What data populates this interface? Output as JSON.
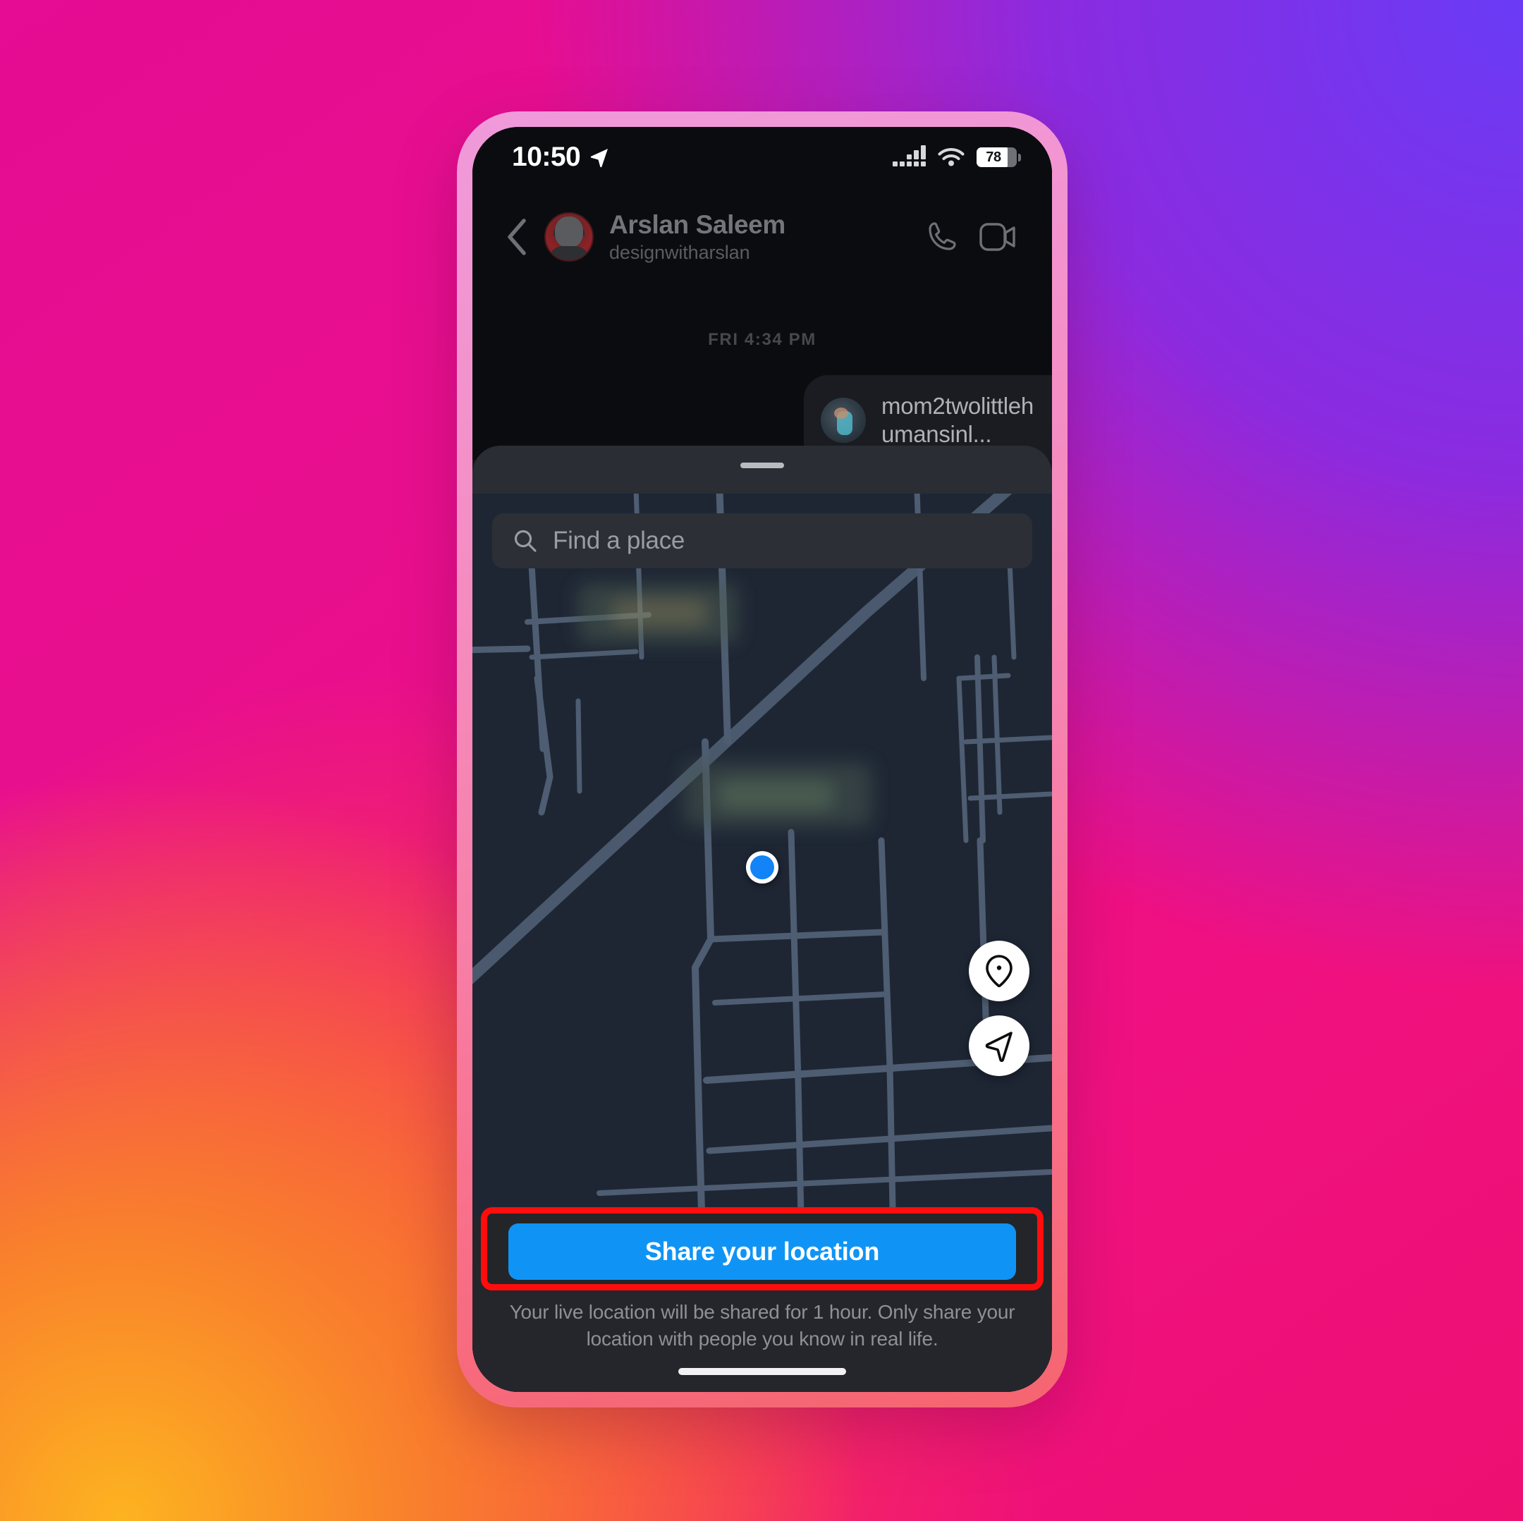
{
  "status_bar": {
    "time": "10:50",
    "location_arrow_icon": "location-arrow-icon",
    "signal_icon": "cellular-signal-icon",
    "wifi_icon": "wifi-icon",
    "battery_icon": "battery-icon",
    "battery_level": "78"
  },
  "chat": {
    "back_icon": "chevron-left-icon",
    "avatar_icon": "contact-avatar",
    "display_name": "Arslan Saleem",
    "username": "designwitharslan",
    "audio_call_icon": "phone-icon",
    "video_call_icon": "video-camera-icon",
    "timestamp": "FRI 4:34 PM",
    "message": {
      "thumb_icon": "shared-post-thumbnail",
      "text": "mom2twolittlehumansinl..."
    }
  },
  "map_sheet": {
    "drag_handle_icon": "sheet-drag-handle",
    "search": {
      "icon": "search-icon",
      "placeholder": "Find a place",
      "value": ""
    },
    "user_dot_icon": "current-location-dot",
    "pin_button_icon": "map-pin-icon",
    "recenter_button_icon": "navigation-arrow-icon"
  },
  "bottom": {
    "share_label": "Share your location",
    "disclaimer": "Your live location will be shared for 1 hour. Only share your location with people you know in real life.",
    "home_indicator_icon": "home-indicator"
  },
  "colors": {
    "accent_blue": "#0F94F5",
    "highlight_red": "#FF0D0D",
    "map_background": "#1E2634",
    "map_road": "#4E5D72",
    "sheet_background": "#24262B",
    "screen_background": "#0B0C0F"
  }
}
